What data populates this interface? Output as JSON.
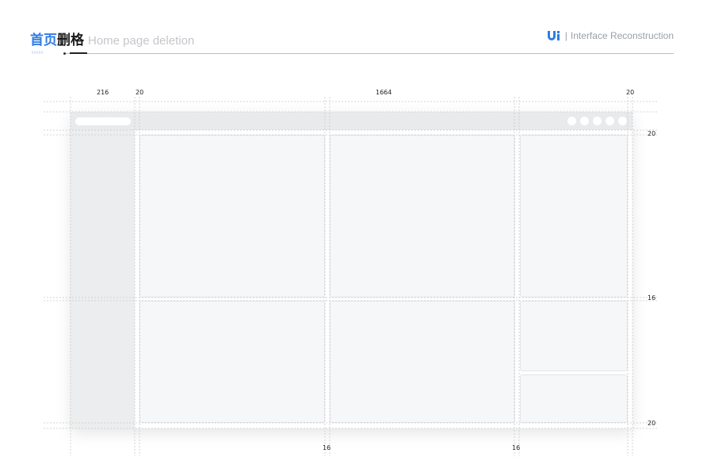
{
  "header": {
    "title_cn_blue": "首页",
    "title_cn_black": "删格",
    "title_en": "Home page deletion",
    "chevrons": "›››››",
    "brand_sep": "|",
    "brand_text": "Interface Reconstruction"
  },
  "colors": {
    "accent": "#2f7de1",
    "card_fill": "#f6f7f9",
    "sidebar_fill": "#ecedee",
    "topbar_fill": "#e9eaec"
  },
  "icons": {
    "brand_logo": "ui-logo-icon",
    "topbar_icons": [
      "circle-icon",
      "circle-icon",
      "circle-icon",
      "circle-icon",
      "circle-icon"
    ]
  },
  "dimensions": {
    "top": {
      "sidebar_width": "216",
      "left_gap": "20",
      "content_width": "1664",
      "right_gap": "20"
    },
    "right": {
      "top_gap": "20",
      "row_gap": "16",
      "bottom_gap": "20"
    },
    "bottom": {
      "col_gap_1": "16",
      "col_gap_2": "16"
    }
  }
}
